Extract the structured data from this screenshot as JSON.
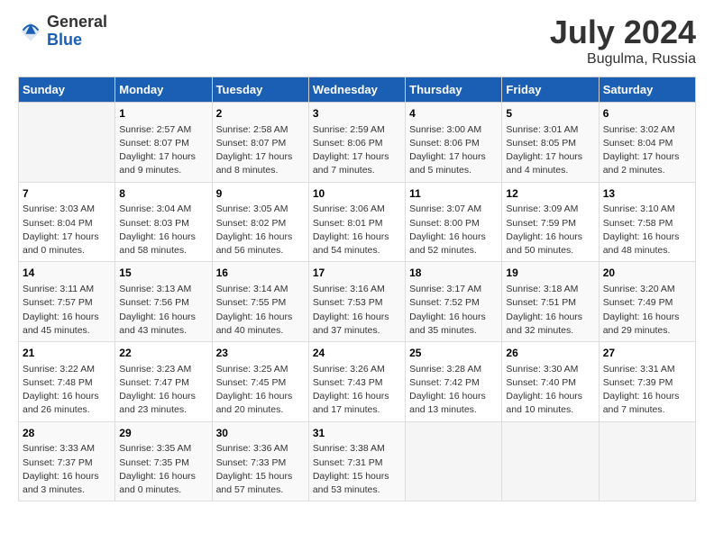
{
  "header": {
    "logo": {
      "general": "General",
      "blue": "Blue"
    },
    "title": "July 2024",
    "location": "Bugulma, Russia"
  },
  "columns": [
    "Sunday",
    "Monday",
    "Tuesday",
    "Wednesday",
    "Thursday",
    "Friday",
    "Saturday"
  ],
  "weeks": [
    [
      {
        "day": "",
        "info": ""
      },
      {
        "day": "1",
        "info": "Sunrise: 2:57 AM\nSunset: 8:07 PM\nDaylight: 17 hours\nand 9 minutes."
      },
      {
        "day": "2",
        "info": "Sunrise: 2:58 AM\nSunset: 8:07 PM\nDaylight: 17 hours\nand 8 minutes."
      },
      {
        "day": "3",
        "info": "Sunrise: 2:59 AM\nSunset: 8:06 PM\nDaylight: 17 hours\nand 7 minutes."
      },
      {
        "day": "4",
        "info": "Sunrise: 3:00 AM\nSunset: 8:06 PM\nDaylight: 17 hours\nand 5 minutes."
      },
      {
        "day": "5",
        "info": "Sunrise: 3:01 AM\nSunset: 8:05 PM\nDaylight: 17 hours\nand 4 minutes."
      },
      {
        "day": "6",
        "info": "Sunrise: 3:02 AM\nSunset: 8:04 PM\nDaylight: 17 hours\nand 2 minutes."
      }
    ],
    [
      {
        "day": "7",
        "info": "Sunrise: 3:03 AM\nSunset: 8:04 PM\nDaylight: 17 hours\nand 0 minutes."
      },
      {
        "day": "8",
        "info": "Sunrise: 3:04 AM\nSunset: 8:03 PM\nDaylight: 16 hours\nand 58 minutes."
      },
      {
        "day": "9",
        "info": "Sunrise: 3:05 AM\nSunset: 8:02 PM\nDaylight: 16 hours\nand 56 minutes."
      },
      {
        "day": "10",
        "info": "Sunrise: 3:06 AM\nSunset: 8:01 PM\nDaylight: 16 hours\nand 54 minutes."
      },
      {
        "day": "11",
        "info": "Sunrise: 3:07 AM\nSunset: 8:00 PM\nDaylight: 16 hours\nand 52 minutes."
      },
      {
        "day": "12",
        "info": "Sunrise: 3:09 AM\nSunset: 7:59 PM\nDaylight: 16 hours\nand 50 minutes."
      },
      {
        "day": "13",
        "info": "Sunrise: 3:10 AM\nSunset: 7:58 PM\nDaylight: 16 hours\nand 48 minutes."
      }
    ],
    [
      {
        "day": "14",
        "info": "Sunrise: 3:11 AM\nSunset: 7:57 PM\nDaylight: 16 hours\nand 45 minutes."
      },
      {
        "day": "15",
        "info": "Sunrise: 3:13 AM\nSunset: 7:56 PM\nDaylight: 16 hours\nand 43 minutes."
      },
      {
        "day": "16",
        "info": "Sunrise: 3:14 AM\nSunset: 7:55 PM\nDaylight: 16 hours\nand 40 minutes."
      },
      {
        "day": "17",
        "info": "Sunrise: 3:16 AM\nSunset: 7:53 PM\nDaylight: 16 hours\nand 37 minutes."
      },
      {
        "day": "18",
        "info": "Sunrise: 3:17 AM\nSunset: 7:52 PM\nDaylight: 16 hours\nand 35 minutes."
      },
      {
        "day": "19",
        "info": "Sunrise: 3:18 AM\nSunset: 7:51 PM\nDaylight: 16 hours\nand 32 minutes."
      },
      {
        "day": "20",
        "info": "Sunrise: 3:20 AM\nSunset: 7:49 PM\nDaylight: 16 hours\nand 29 minutes."
      }
    ],
    [
      {
        "day": "21",
        "info": "Sunrise: 3:22 AM\nSunset: 7:48 PM\nDaylight: 16 hours\nand 26 minutes."
      },
      {
        "day": "22",
        "info": "Sunrise: 3:23 AM\nSunset: 7:47 PM\nDaylight: 16 hours\nand 23 minutes."
      },
      {
        "day": "23",
        "info": "Sunrise: 3:25 AM\nSunset: 7:45 PM\nDaylight: 16 hours\nand 20 minutes."
      },
      {
        "day": "24",
        "info": "Sunrise: 3:26 AM\nSunset: 7:43 PM\nDaylight: 16 hours\nand 17 minutes."
      },
      {
        "day": "25",
        "info": "Sunrise: 3:28 AM\nSunset: 7:42 PM\nDaylight: 16 hours\nand 13 minutes."
      },
      {
        "day": "26",
        "info": "Sunrise: 3:30 AM\nSunset: 7:40 PM\nDaylight: 16 hours\nand 10 minutes."
      },
      {
        "day": "27",
        "info": "Sunrise: 3:31 AM\nSunset: 7:39 PM\nDaylight: 16 hours\nand 7 minutes."
      }
    ],
    [
      {
        "day": "28",
        "info": "Sunrise: 3:33 AM\nSunset: 7:37 PM\nDaylight: 16 hours\nand 3 minutes."
      },
      {
        "day": "29",
        "info": "Sunrise: 3:35 AM\nSunset: 7:35 PM\nDaylight: 16 hours\nand 0 minutes."
      },
      {
        "day": "30",
        "info": "Sunrise: 3:36 AM\nSunset: 7:33 PM\nDaylight: 15 hours\nand 57 minutes."
      },
      {
        "day": "31",
        "info": "Sunrise: 3:38 AM\nSunset: 7:31 PM\nDaylight: 15 hours\nand 53 minutes."
      },
      {
        "day": "",
        "info": ""
      },
      {
        "day": "",
        "info": ""
      },
      {
        "day": "",
        "info": ""
      }
    ]
  ]
}
